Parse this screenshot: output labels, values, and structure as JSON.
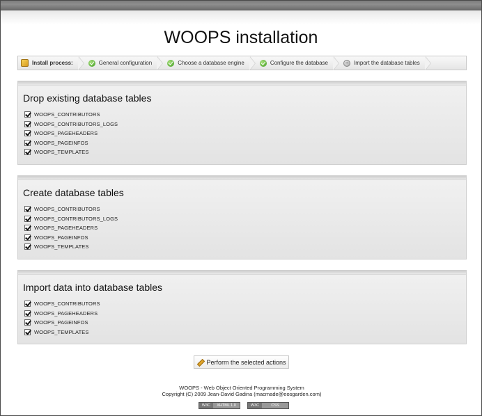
{
  "page": {
    "title": "WOOPS installation"
  },
  "steps": [
    {
      "label": "Install process:",
      "icon": "install-icon",
      "status": "header"
    },
    {
      "label": "General configuration",
      "icon": "check-icon",
      "status": "done"
    },
    {
      "label": "Choose a database engine",
      "icon": "check-icon",
      "status": "done"
    },
    {
      "label": "Configure the database",
      "icon": "check-icon",
      "status": "done"
    },
    {
      "label": "Import the database tables",
      "icon": "pending-icon",
      "status": "current"
    }
  ],
  "sections": [
    {
      "title": "Drop existing database tables",
      "items": [
        {
          "label": "WOOPS_CONTRIBUTORS",
          "checked": true
        },
        {
          "label": "WOOPS_CONTRIBUTORS_LOGS",
          "checked": true
        },
        {
          "label": "WOOPS_PAGEHEADERS",
          "checked": true
        },
        {
          "label": "WOOPS_PAGEINFOS",
          "checked": true
        },
        {
          "label": "WOOPS_TEMPLATES",
          "checked": true
        }
      ]
    },
    {
      "title": "Create database tables",
      "items": [
        {
          "label": "WOOPS_CONTRIBUTORS",
          "checked": true
        },
        {
          "label": "WOOPS_CONTRIBUTORS_LOGS",
          "checked": true
        },
        {
          "label": "WOOPS_PAGEHEADERS",
          "checked": true
        },
        {
          "label": "WOOPS_PAGEINFOS",
          "checked": true
        },
        {
          "label": "WOOPS_TEMPLATES",
          "checked": true
        }
      ]
    },
    {
      "title": "Import data into database tables",
      "items": [
        {
          "label": "WOOPS_CONTRIBUTORS",
          "checked": true
        },
        {
          "label": "WOOPS_PAGEHEADERS",
          "checked": true
        },
        {
          "label": "WOOPS_PAGEINFOS",
          "checked": true
        },
        {
          "label": "WOOPS_TEMPLATES",
          "checked": true
        }
      ]
    }
  ],
  "action": {
    "label": "Perform the selected actions",
    "icon": "pencil-icon"
  },
  "footer": {
    "line1": "WOOPS - Web Object Oriented Programming System",
    "line2": "Copyright (C) 2009 Jean-David Gadina (macmade@eosgarden.com)"
  },
  "badges": [
    {
      "left": "W3C",
      "right": "XHTML 1.0"
    },
    {
      "left": "W3C",
      "right": "CSS"
    }
  ],
  "colors": {
    "topbar": "#7d7d7d",
    "panel_bg": "#e9e9e9",
    "check_green": "#3c9a1e"
  }
}
